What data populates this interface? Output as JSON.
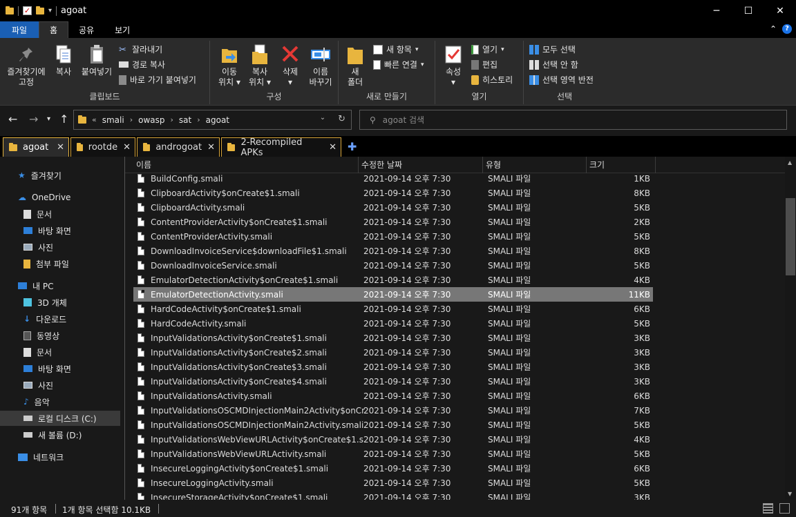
{
  "window": {
    "title": "agoat"
  },
  "ribbon_tabs": [
    "파일",
    "홈",
    "공유",
    "보기"
  ],
  "ribbon": {
    "clipboard": {
      "pin_label": "즐겨찾기에\n고정",
      "pin_line1": "즐겨찾기에",
      "pin_line2": "고정",
      "copy": "복사",
      "paste": "붙여넣기",
      "cut": "잘라내기",
      "copy_path": "경로 복사",
      "paste_shortcut": "바로 가기 붙여넣기",
      "group": "클립보드"
    },
    "organize": {
      "move_line1": "이동",
      "move_line2": "위치",
      "copy_line1": "복사",
      "copy_line2": "위치",
      "delete": "삭제",
      "rename_line1": "이름",
      "rename_line2": "바꾸기",
      "group": "구성"
    },
    "new": {
      "folder_line1": "새",
      "folder_line2": "폴더",
      "new_item": "새 항목",
      "easy_access": "빠른 연결",
      "group": "새로 만들기"
    },
    "open": {
      "properties": "속성",
      "open": "열기",
      "edit": "편집",
      "history": "히스토리",
      "group": "열기"
    },
    "select": {
      "select_all": "모두 선택",
      "select_none": "선택 안 함",
      "invert": "선택 영역 반전",
      "group": "선택"
    }
  },
  "address": {
    "overflow": "«",
    "crumbs": [
      "smali",
      "owasp",
      "sat",
      "agoat"
    ],
    "search_placeholder": "agoat 검색"
  },
  "tabs": [
    {
      "label": "agoat",
      "active": true
    },
    {
      "label": "rootde",
      "active": false
    },
    {
      "label": "androgoat",
      "active": false
    },
    {
      "label": "2-Recompiled APKs",
      "active": false
    }
  ],
  "nav": [
    {
      "label": "즐겨찾기",
      "icon": "star-icon"
    },
    {
      "label": "OneDrive",
      "icon": "cloud-icon"
    },
    {
      "label": "문서",
      "icon": "document-icon"
    },
    {
      "label": "바탕 화면",
      "icon": "desktop-icon"
    },
    {
      "label": "사진",
      "icon": "pictures-icon"
    },
    {
      "label": "첨부 파일",
      "icon": "folder-icon"
    },
    {
      "label": "내 PC",
      "icon": "pc-icon"
    },
    {
      "label": "3D 개체",
      "icon": "cube-icon"
    },
    {
      "label": "다운로드",
      "icon": "download-icon"
    },
    {
      "label": "동영상",
      "icon": "video-icon"
    },
    {
      "label": "문서",
      "icon": "document-icon"
    },
    {
      "label": "바탕 화면",
      "icon": "desktop-icon"
    },
    {
      "label": "사진",
      "icon": "pictures-icon"
    },
    {
      "label": "음악",
      "icon": "music-icon"
    },
    {
      "label": "로컬 디스크 (C:)",
      "icon": "drive-icon"
    },
    {
      "label": "새 볼륨 (D:)",
      "icon": "drive-icon"
    },
    {
      "label": "네트워크",
      "icon": "network-icon"
    }
  ],
  "columns": {
    "name": "이름",
    "date": "수정한 날짜",
    "type": "유형",
    "size": "크기"
  },
  "files": [
    {
      "name": "BuildConfig.smali",
      "date": "2021-09-14 오후 7:30",
      "type": "SMALI 파일",
      "size": "1KB"
    },
    {
      "name": "ClipboardActivity$onCreate$1.smali",
      "date": "2021-09-14 오후 7:30",
      "type": "SMALI 파일",
      "size": "8KB"
    },
    {
      "name": "ClipboardActivity.smali",
      "date": "2021-09-14 오후 7:30",
      "type": "SMALI 파일",
      "size": "5KB"
    },
    {
      "name": "ContentProviderActivity$onCreate$1.smali",
      "date": "2021-09-14 오후 7:30",
      "type": "SMALI 파일",
      "size": "2KB"
    },
    {
      "name": "ContentProviderActivity.smali",
      "date": "2021-09-14 오후 7:30",
      "type": "SMALI 파일",
      "size": "5KB"
    },
    {
      "name": "DownloadInvoiceService$downloadFile$1.smali",
      "date": "2021-09-14 오후 7:30",
      "type": "SMALI 파일",
      "size": "8KB"
    },
    {
      "name": "DownloadInvoiceService.smali",
      "date": "2021-09-14 오후 7:30",
      "type": "SMALI 파일",
      "size": "5KB"
    },
    {
      "name": "EmulatorDetectionActivity$onCreate$1.smali",
      "date": "2021-09-14 오후 7:30",
      "type": "SMALI 파일",
      "size": "4KB"
    },
    {
      "name": "EmulatorDetectionActivity.smali",
      "date": "2021-09-14 오후 7:30",
      "type": "SMALI 파일",
      "size": "11KB",
      "selected": true
    },
    {
      "name": "HardCodeActivity$onCreate$1.smali",
      "date": "2021-09-14 오후 7:30",
      "type": "SMALI 파일",
      "size": "6KB"
    },
    {
      "name": "HardCodeActivity.smali",
      "date": "2021-09-14 오후 7:30",
      "type": "SMALI 파일",
      "size": "5KB"
    },
    {
      "name": "InputValidationsActivity$onCreate$1.smali",
      "date": "2021-09-14 오후 7:30",
      "type": "SMALI 파일",
      "size": "3KB"
    },
    {
      "name": "InputValidationsActivity$onCreate$2.smali",
      "date": "2021-09-14 오후 7:30",
      "type": "SMALI 파일",
      "size": "3KB"
    },
    {
      "name": "InputValidationsActivity$onCreate$3.smali",
      "date": "2021-09-14 오후 7:30",
      "type": "SMALI 파일",
      "size": "3KB"
    },
    {
      "name": "InputValidationsActivity$onCreate$4.smali",
      "date": "2021-09-14 오후 7:30",
      "type": "SMALI 파일",
      "size": "3KB"
    },
    {
      "name": "InputValidationsActivity.smali",
      "date": "2021-09-14 오후 7:30",
      "type": "SMALI 파일",
      "size": "6KB"
    },
    {
      "name": "InputValidationsOSCMDInjectionMain2Activity$onCr...",
      "date": "2021-09-14 오후 7:30",
      "type": "SMALI 파일",
      "size": "7KB"
    },
    {
      "name": "InputValidationsOSCMDInjectionMain2Activity.smali",
      "date": "2021-09-14 오후 7:30",
      "type": "SMALI 파일",
      "size": "5KB"
    },
    {
      "name": "InputValidationsWebViewURLActivity$onCreate$1.s...",
      "date": "2021-09-14 오후 7:30",
      "type": "SMALI 파일",
      "size": "4KB"
    },
    {
      "name": "InputValidationsWebViewURLActivity.smali",
      "date": "2021-09-14 오후 7:30",
      "type": "SMALI 파일",
      "size": "5KB"
    },
    {
      "name": "InsecureLoggingActivity$onCreate$1.smali",
      "date": "2021-09-14 오후 7:30",
      "type": "SMALI 파일",
      "size": "6KB"
    },
    {
      "name": "InsecureLoggingActivity.smali",
      "date": "2021-09-14 오후 7:30",
      "type": "SMALI 파일",
      "size": "5KB"
    },
    {
      "name": "InsecureStorageActivity$onCreate$1.smali",
      "date": "2021-09-14 오후 7:30",
      "type": "SMALI 파일",
      "size": "3KB"
    }
  ],
  "status": {
    "count": "91개 항목",
    "selected": "1개 항목 선택함 10.1KB"
  },
  "colors": {
    "selection": "#777777",
    "folder": "#e8b53e",
    "accent": "#1a5fb4"
  }
}
